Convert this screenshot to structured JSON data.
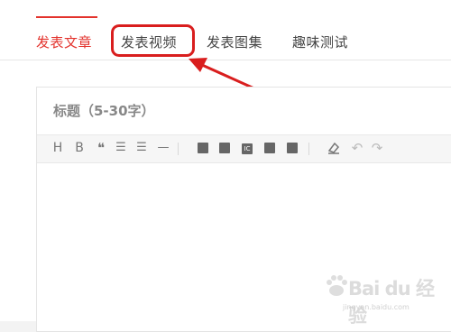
{
  "tabs": [
    {
      "label": "发表文章",
      "active": true
    },
    {
      "label": "发表视频",
      "active": false
    },
    {
      "label": "发表图集",
      "active": false
    },
    {
      "label": "趣味测试",
      "active": false
    }
  ],
  "editor": {
    "title_placeholder": "标题（5-30字）",
    "toolbar": [
      {
        "label": "H",
        "icon": "heading-icon"
      },
      {
        "label": "B",
        "icon": "bold-icon"
      },
      {
        "label": "❝",
        "icon": "quote-icon"
      },
      {
        "label": "☰",
        "icon": "bullet-list-icon"
      },
      {
        "label": "☰",
        "icon": "numbered-list-icon"
      },
      {
        "label": "—",
        "icon": "horizontal-rule-icon"
      },
      {
        "label": "",
        "icon": "insert-document-icon"
      },
      {
        "label": "",
        "icon": "insert-image-icon"
      },
      {
        "label": "IC",
        "icon": "insert-ic-icon"
      },
      {
        "label": "",
        "icon": "insert-video-icon"
      },
      {
        "label": "",
        "icon": "insert-chart-icon"
      },
      {
        "label": "",
        "icon": "clear-format-icon"
      },
      {
        "label": "↶",
        "icon": "undo-icon"
      },
      {
        "label": "↷",
        "icon": "redo-icon"
      }
    ]
  },
  "watermark": {
    "text": "Bai du 经验",
    "url": "jingyan.baidu.com"
  },
  "colors": {
    "accent": "#e3332d",
    "annotation": "#d91e1e"
  }
}
